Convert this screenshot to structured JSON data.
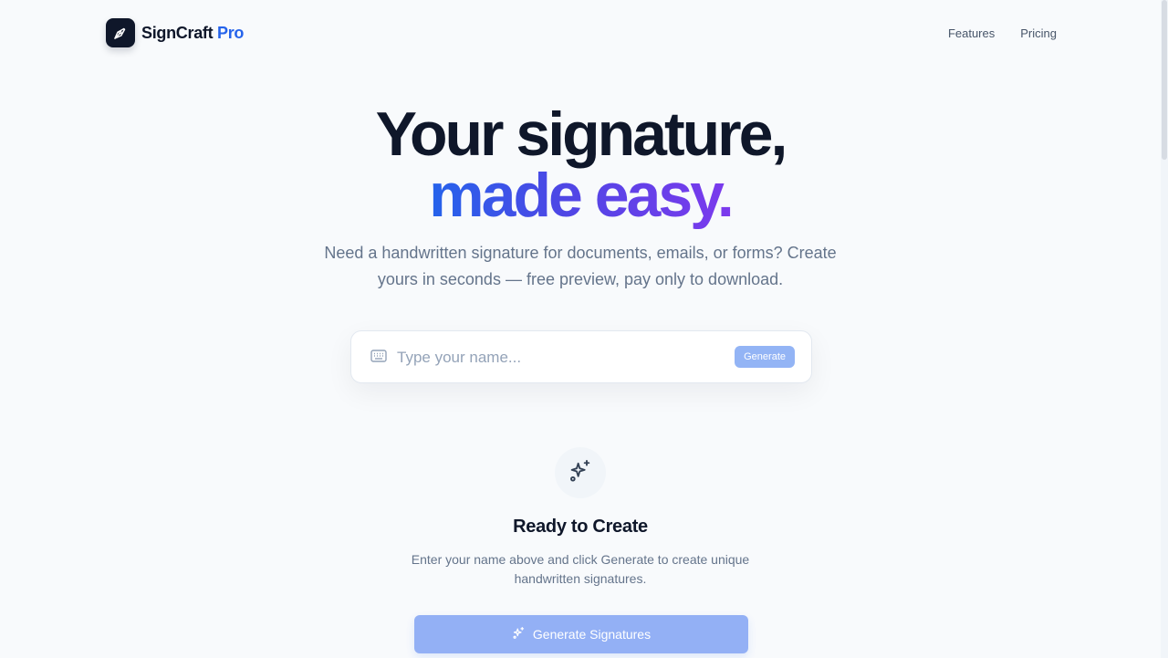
{
  "brand": {
    "name": "SignCraft",
    "accent": "Pro",
    "logo_icon": "pen-nib-icon"
  },
  "nav": {
    "features": "Features",
    "pricing": "Pricing"
  },
  "hero": {
    "line1": "Your signature,",
    "line2": "made easy.",
    "subtitle": "Need a handwritten signature for documents, emails, or forms? Create yours in seconds — free preview, pay only to download."
  },
  "input": {
    "icon": "keyboard-icon",
    "placeholder": "Type your name...",
    "value": "",
    "button": "Generate"
  },
  "empty_state": {
    "icon": "sparkles-icon",
    "title": "Ready to Create",
    "description": "Enter your name above and click Generate to create unique handwritten signatures.",
    "button": "Generate Signatures"
  },
  "colors": {
    "brand_dark": "#0f172a",
    "accent_blue": "#2563eb",
    "accent_purple": "#7c3aed",
    "disabled_button": "#93b4f5",
    "background": "#f8fafc"
  }
}
